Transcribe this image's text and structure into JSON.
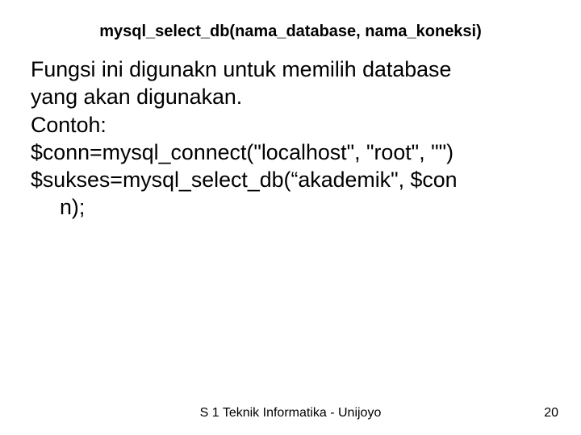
{
  "slide": {
    "title": "mysql_select_db(nama_database, nama_koneksi)",
    "body": {
      "line1": "Fungsi ini digunakn untuk memilih database",
      "line2": "yang akan digunakan.",
      "line3": "Contoh:",
      "line4": "$conn=mysql_connect(\"localhost\", \"root\", \"\")",
      "line5": "$sukses=mysql_select_db(“akademik\", $con",
      "line6": "n);"
    },
    "footer": {
      "center": "S 1 Teknik Informatika - Unijoyo",
      "page": "20"
    }
  }
}
